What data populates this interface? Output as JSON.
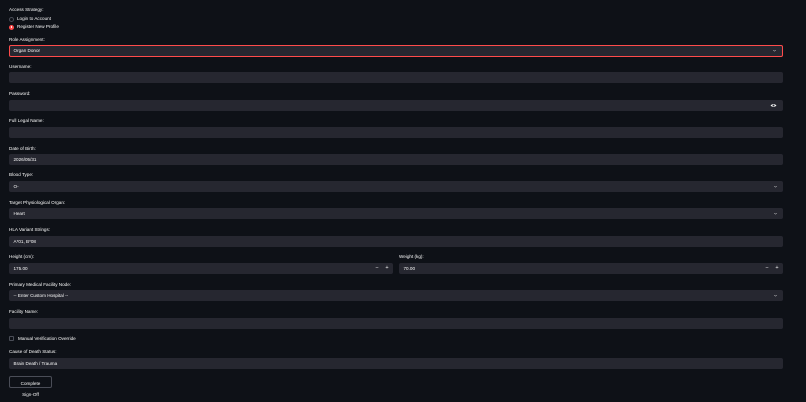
{
  "access": {
    "label": "Access Strategy:",
    "options": [
      "Login to Account",
      "Register New Profile"
    ],
    "selected": "Register New Profile"
  },
  "role": {
    "label": "Role Assignment:",
    "value": "Organ Donor"
  },
  "username": {
    "label": "Username:",
    "value": ""
  },
  "password": {
    "label": "Password:",
    "value": ""
  },
  "full_name": {
    "label": "Full Legal Name:",
    "value": ""
  },
  "dob": {
    "label": "Date of Birth:",
    "value": "2026/05/31"
  },
  "blood": {
    "label": "Blood Type:",
    "value": "O-"
  },
  "organ": {
    "label": "Target Physiological Organ:",
    "value": "Heart"
  },
  "hla": {
    "label": "HLA Variant Strings:",
    "value": "A*01, B*08"
  },
  "height": {
    "label": "Height (cm):",
    "value": "175.00",
    "minus": "−",
    "plus": "+"
  },
  "weight": {
    "label": "Weight (kg):",
    "value": "70.00",
    "minus": "−",
    "plus": "+"
  },
  "facility_node": {
    "label": "Primary Medical Facility Node:",
    "value": "-- Enter Custom Hospital --"
  },
  "facility_name": {
    "label": "Facility Name:",
    "value": ""
  },
  "manual_override": {
    "label": "Manual Verification Override",
    "checked": false
  },
  "death_status": {
    "label": "Cause of Death Status:",
    "value": "Brain Death / Trauma"
  },
  "submit": {
    "label": "Complete Sign-Off"
  },
  "colors": {
    "background": "#0e1117",
    "input": "#262730",
    "accent": "#ff4b4b",
    "text": "#fafafa"
  }
}
